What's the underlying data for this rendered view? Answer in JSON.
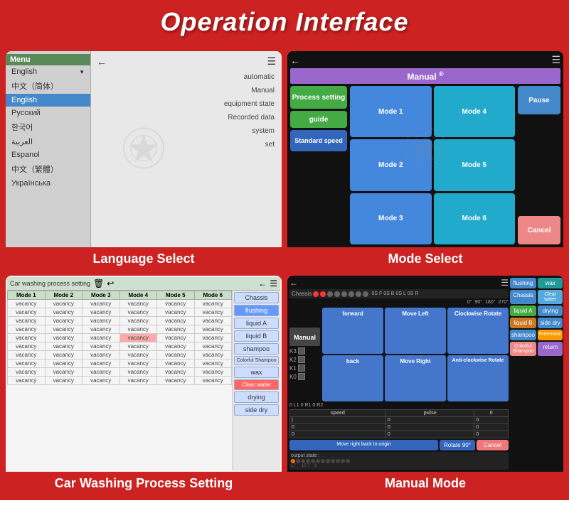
{
  "header": {
    "title": "Operation Interface"
  },
  "panel1": {
    "label": "Language Select",
    "menu_title": "Menu",
    "languages": [
      {
        "name": "English",
        "arrow": true
      },
      {
        "name": "中文（简体）",
        "arrow": false
      },
      {
        "name": "English",
        "active": true
      },
      {
        "name": "Русский",
        "arrow": false
      },
      {
        "name": "한국어",
        "arrow": false
      },
      {
        "name": "العربية",
        "arrow": false
      },
      {
        "name": "Espanol",
        "arrow": false
      },
      {
        "name": "中文（繁體）",
        "arrow": false
      },
      {
        "name": "Українська",
        "arrow": false
      }
    ],
    "nav_items": [
      "automatic",
      "Manual",
      "equipment state",
      "Recorded data",
      "system",
      "set"
    ]
  },
  "panel2": {
    "label": "Mode Select",
    "title": "Manual",
    "left_buttons": [
      "Process setting",
      "guide",
      "Standard speed"
    ],
    "mode_buttons": [
      "Mode 1",
      "Mode 2",
      "Mode 3",
      "Mode 4",
      "Mode 5",
      "Mode 6"
    ],
    "right_buttons": [
      "Pause",
      "Cancel"
    ]
  },
  "panel3": {
    "label": "Car Washing Process Setting",
    "title": "Car washing process setting",
    "columns": [
      "Mode 1",
      "Mode 2",
      "Mode 3",
      "Mode 4",
      "Mode 5",
      "Mode 6"
    ],
    "row_labels": [
      "Chassis",
      "flushing",
      "liquid A",
      "liquid B",
      "shampoo",
      "Colorful Shampoo",
      "wax",
      "Clear water",
      "drying",
      "side dry"
    ],
    "right_buttons": [
      "Chassis",
      "flushing",
      "liquid A",
      "liquid B",
      "shampoo",
      "Colorful Shampoo",
      "wax",
      "Clear water",
      "drying",
      "side dry"
    ]
  },
  "panel4": {
    "label": "Manual Mode",
    "chassis_label": "Chassis",
    "angles": [
      "0S F",
      "0S B",
      "0S L",
      "0S R",
      "0°",
      "90°",
      "180°",
      "270°"
    ],
    "manual_title": "Manual",
    "k_labels": [
      "K3",
      "K2",
      "K1",
      "K0"
    ],
    "nav_buttons": [
      "forward",
      "Move Left",
      "Clockwise Rotate",
      "back",
      "Move Right",
      "Anti-clockwise Rotate"
    ],
    "bottom_buttons": [
      "Move right back to origin",
      "Rotate 90°",
      "Cancel"
    ],
    "speed_cols": [
      "speed",
      "pulse",
      "0"
    ],
    "right_buttons": [
      "flushing",
      "wax",
      "Chassis",
      "Clear water",
      "liquid A",
      "drying",
      "liquid B",
      "side dry",
      "shampoo",
      "Freemove",
      "Colorful Shampoo",
      "return"
    ],
    "output_label": "output state :"
  }
}
